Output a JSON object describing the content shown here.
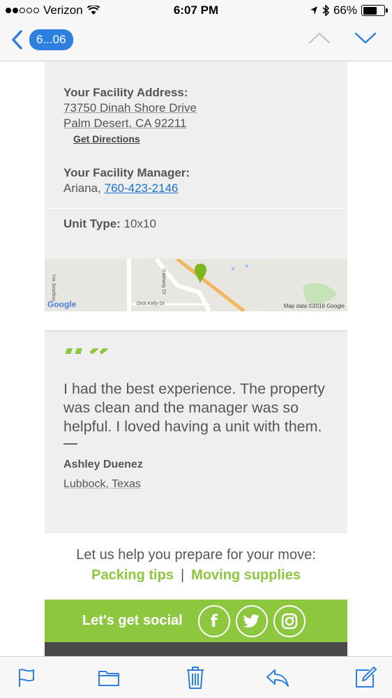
{
  "status_bar": {
    "carrier": "Verizon",
    "time": "6:07 PM",
    "battery": "66%",
    "battery_level": 0.66
  },
  "nav": {
    "back_label": "6...06"
  },
  "facility": {
    "address_label": "Your Facility Address:",
    "address_line1": "73750 Dinah Shore Drive",
    "address_line2": "Palm Desert, CA 92211",
    "directions_label": "Get Directions",
    "manager_label": "Your Facility Manager:",
    "manager_name": "Ariana,",
    "manager_phone": "760-423-2146",
    "unit_label": "Unit Type:",
    "unit_value": "10x10"
  },
  "map": {
    "road1": "Via Josefina",
    "road2": "Gateway Dr",
    "road3": "Dick Kelly Dr",
    "logo": "Google",
    "attribution": "Map data ©2016 Google"
  },
  "testimonial": {
    "text": "I had the best experience. The property was clean and the manager was so helpful. I loved having a unit with them.",
    "author": "Ashley Duenez",
    "location": "Lubbock, Texas"
  },
  "help": {
    "text": "Let us help you prepare for your move:",
    "link1": "Packing tips",
    "separator": "|",
    "link2": "Moving supplies"
  },
  "social": {
    "title": "Let's get social",
    "icons": [
      "facebook-icon",
      "twitter-icon",
      "instagram-icon"
    ]
  },
  "colors": {
    "accent_green": "#8dc63f",
    "ios_blue": "#2d7fe0",
    "link_blue": "#1a73c7"
  }
}
